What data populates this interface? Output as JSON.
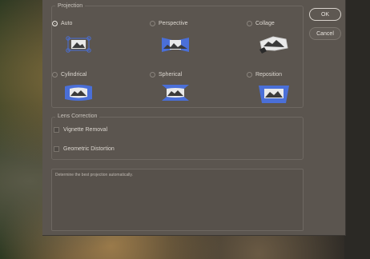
{
  "projection": {
    "title": "Projection",
    "options": [
      {
        "label": "Auto",
        "selected": true
      },
      {
        "label": "Perspective",
        "selected": false
      },
      {
        "label": "Collage",
        "selected": false
      },
      {
        "label": "Cylindrical",
        "selected": false
      },
      {
        "label": "Spherical",
        "selected": false
      },
      {
        "label": "Reposition",
        "selected": false
      }
    ]
  },
  "lens": {
    "title": "Lens Correction",
    "vignette": "Vignette Removal",
    "geometric": "Geometric Distortion"
  },
  "message": "Determine the best projection automatically.",
  "buttons": {
    "ok": "OK",
    "cancel": "Cancel"
  },
  "colors": {
    "dialog": "#5b554f",
    "thumb_blue": "#4a6fd8"
  }
}
